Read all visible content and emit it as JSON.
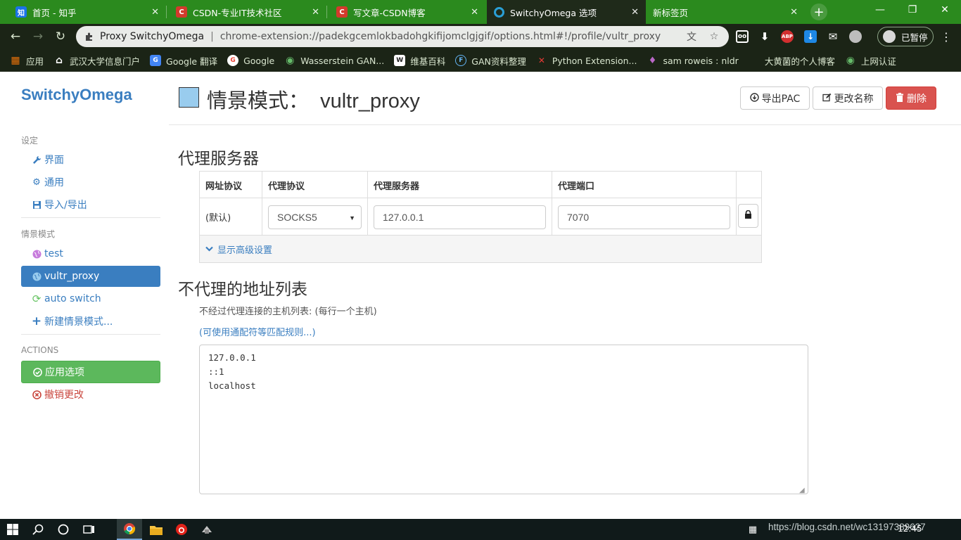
{
  "browser": {
    "tabs": [
      {
        "label": "首页 - 知乎",
        "icon": "zhihu-favicon",
        "icon_char": "知",
        "icon_color": "#1a73e8",
        "active": false
      },
      {
        "label": "CSDN-专业IT技术社区",
        "icon": "csdn-favicon",
        "icon_char": "C",
        "icon_color": "#d33a2c",
        "active": false
      },
      {
        "label": "写文章-CSDN博客",
        "icon": "csdn-favicon",
        "icon_char": "C",
        "icon_color": "#d33a2c",
        "active": false
      },
      {
        "label": "SwitchyOmega 选项",
        "icon": "switchyomega-favicon",
        "icon_char": "○",
        "icon_color": "#2a9fd6",
        "active": true
      },
      {
        "label": "新标签页",
        "icon": "",
        "icon_char": "",
        "icon_color": "",
        "active": false
      }
    ],
    "new_tab": "+",
    "window": {
      "minimize": "—",
      "restore": "❐",
      "close": "✕"
    },
    "omnibox": {
      "origin": "Proxy SwitchyOmega",
      "url": "chrome-extension://padekgcemlokbadohgkifijomclgjgif/options.html#!/profile/vultr_proxy"
    },
    "paused_label": "已暂停",
    "bookmarks": [
      {
        "label": "应用",
        "icon": "apps-grid-icon",
        "icon_char": "▦",
        "icon_color": "#e8710a"
      },
      {
        "label": "武汉大学信息门户",
        "icon": "home-icon",
        "icon_char": "⌂",
        "icon_color": "#1b2416"
      },
      {
        "label": "Google 翻译",
        "icon": "google-translate-icon",
        "icon_char": "G",
        "icon_color": "#4285f4"
      },
      {
        "label": "Google",
        "icon": "google-icon",
        "icon_char": "G",
        "icon_color": "#ea4335"
      },
      {
        "label": "Wasserstein GAN...",
        "icon": "globe-icon",
        "icon_char": "◉",
        "icon_color": "#2e7d32"
      },
      {
        "label": "维基百科",
        "icon": "wikipedia-icon",
        "icon_char": "W",
        "icon_color": "#555555"
      },
      {
        "label": "GAN资料整理",
        "icon": "f-circle-icon",
        "icon_char": "F",
        "icon_color": "#1565c0"
      },
      {
        "label": "Python Extension...",
        "icon": "x-icon",
        "icon_char": "✕",
        "icon_color": "#c62828"
      },
      {
        "label": "sam roweis : nldr",
        "icon": "pin-icon",
        "icon_char": "♦",
        "icon_color": "#6a1b9a"
      },
      {
        "label": "大黄菌的个人博客",
        "icon": "",
        "icon_char": "",
        "icon_color": ""
      },
      {
        "label": "上网认证",
        "icon": "globe-icon",
        "icon_char": "◉",
        "icon_color": "#2e7d32"
      }
    ]
  },
  "sidebar": {
    "brand": "SwitchyOmega",
    "settings_header": "设定",
    "settings_items": [
      {
        "label": "界面",
        "icon": "wrench-icon",
        "icon_char": "🔧"
      },
      {
        "label": "通用",
        "icon": "gear-icon",
        "icon_char": "⚙"
      },
      {
        "label": "导入/导出",
        "icon": "floppy-icon",
        "icon_char": "⬒"
      }
    ],
    "profiles_header": "情景模式",
    "profiles": [
      {
        "label": "test",
        "icon": "globe-icon",
        "icon_char": "●",
        "icon_color": "#c77bdc",
        "active": false
      },
      {
        "label": "vultr_proxy",
        "icon": "globe-icon",
        "icon_char": "●",
        "icon_color": "#99ccee",
        "active": true
      },
      {
        "label": "auto switch",
        "icon": "refresh-icon",
        "icon_char": "⟳",
        "icon_color": "#68c464",
        "active": false
      },
      {
        "label": "新建情景模式...",
        "icon": "plus-icon",
        "icon_char": "+",
        "icon_color": "#3a7ec0",
        "active": false
      }
    ],
    "actions_header": "ACTIONS",
    "apply_label": "应用选项",
    "discard_label": "撤销更改"
  },
  "main": {
    "title_prefix": "情景模式：",
    "profile_name": "vultr_proxy",
    "profile_color": "#99ccee",
    "buttons": {
      "export_pac": "导出PAC",
      "rename": "更改名称",
      "delete": "删除"
    },
    "proxy_section_title": "代理服务器",
    "proxy_table": {
      "headers": [
        "网址协议",
        "代理协议",
        "代理服务器",
        "代理端口"
      ],
      "row": {
        "scheme": "(默认)",
        "protocol": "SOCKS5",
        "server": "127.0.0.1",
        "port": "7070"
      },
      "advanced_label": "显示高级设置"
    },
    "bypass_section_title": "不代理的地址列表",
    "bypass_help": "不经过代理连接的主机列表: (每行一个主机)",
    "bypass_wildcard_link": "(可使用通配符等匹配规则...)",
    "bypass_list": "127.0.0.1\n::1\nlocalhost"
  },
  "taskbar": {
    "watermark": "https://blog.csdn.net/wc13197389627",
    "clock": "12:45"
  },
  "colors": {
    "accent": "#3a7ec0",
    "success": "#5cb85c",
    "danger": "#d9534f",
    "tabbar": "#2b8a1e"
  }
}
